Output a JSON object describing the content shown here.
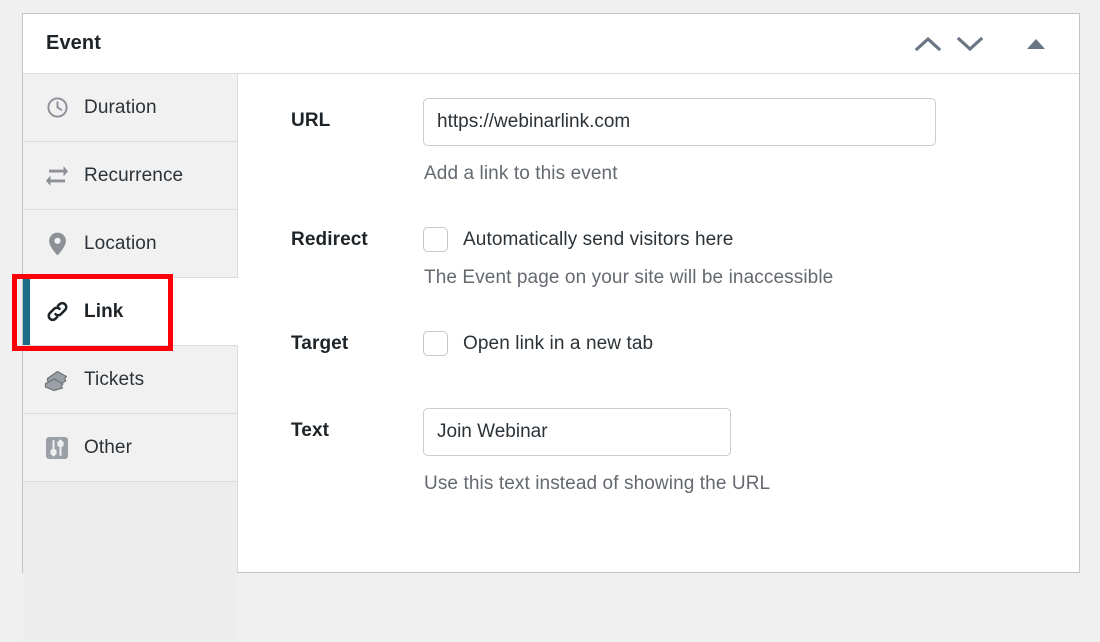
{
  "panel": {
    "title": "Event",
    "header_controls": [
      {
        "name": "move-up-button",
        "icon": "chevron-up-icon"
      },
      {
        "name": "move-down-button",
        "icon": "chevron-down-icon"
      },
      {
        "name": "collapse-panel-button",
        "icon": "triangle-up-icon"
      }
    ]
  },
  "tabs": [
    {
      "label": "Duration",
      "icon": "clock-icon",
      "active": false
    },
    {
      "label": "Recurrence",
      "icon": "repeat-icon",
      "active": false
    },
    {
      "label": "Location",
      "icon": "map-pin-icon",
      "active": false
    },
    {
      "label": "Link",
      "icon": "link-chain-icon",
      "active": true
    },
    {
      "label": "Tickets",
      "icon": "tickets-icon",
      "active": false
    },
    {
      "label": "Other",
      "icon": "sliders-icon",
      "active": false
    }
  ],
  "form": {
    "url": {
      "label": "URL",
      "value": "https://webinarlink.com",
      "placeholder": "",
      "help": "Add a link to this event"
    },
    "redirect": {
      "label": "Redirect",
      "checkbox_label": "Automatically send visitors here",
      "checked": false,
      "help": "The Event page on your site will be inaccessible"
    },
    "target": {
      "label": "Target",
      "checkbox_label": "Open link in a new tab",
      "checked": false
    },
    "text": {
      "label": "Text",
      "value": "Join Webinar",
      "placeholder": "",
      "help": "Use this text instead of showing the URL"
    }
  },
  "annotation": {
    "color": "#fb0007",
    "target": "Link"
  },
  "colors": {
    "accent_active_tab": "#1b6c86",
    "page_background": "#f0f0f1",
    "sidebar_background": "#f1f1f1",
    "help_text": "#646970"
  }
}
